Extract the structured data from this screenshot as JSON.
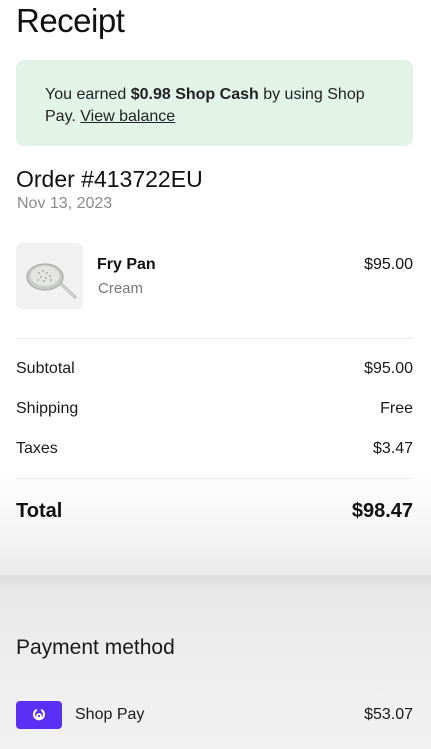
{
  "header": {
    "title": "Receipt"
  },
  "shop_cash": {
    "prefix": "You earned ",
    "amount_text": "$0.98 Shop Cash",
    "suffix": " by using Shop Pay. ",
    "link_label": "View balance",
    "background": "#e2f3e8"
  },
  "order": {
    "title": "Order #413722EU",
    "date": "Nov 13, 2023"
  },
  "items": [
    {
      "name": "Fry Pan",
      "variant": "Cream",
      "price": "$95.00",
      "icon": "fry-pan-image"
    }
  ],
  "summary": {
    "subtotal_label": "Subtotal",
    "subtotal_value": "$95.00",
    "shipping_label": "Shipping",
    "shipping_value": "Free",
    "taxes_label": "Taxes",
    "taxes_value": "$3.47"
  },
  "total": {
    "label": "Total",
    "value": "$98.47"
  },
  "payment": {
    "heading": "Payment method",
    "method_label": "Shop Pay",
    "method_amount": "$53.07",
    "badge_color": "#5a31f4",
    "icon": "shop-pay-icon"
  }
}
